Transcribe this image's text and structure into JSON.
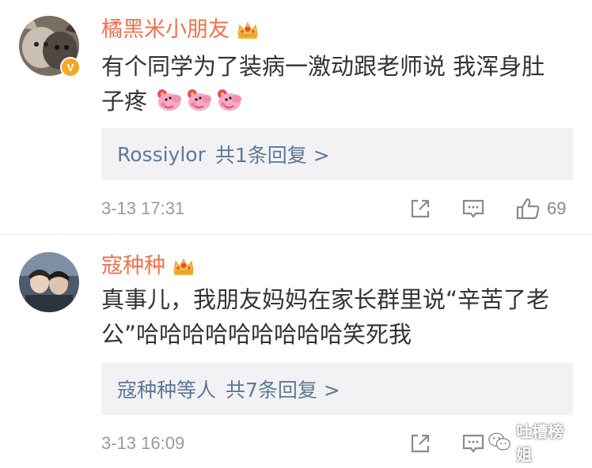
{
  "comments": [
    {
      "username": "橘黑米小朋友",
      "verified_badge": "V",
      "content_text": "有个同学为了装病一激动跟老师说 我浑身肚子疼",
      "content_line1": "有个同学为了装病一激动跟老师说 我浑身肚",
      "content_line2": "子疼",
      "emoji": [
        "peppa-pig-icon",
        "peppa-pig-icon",
        "peppa-pig-icon"
      ],
      "reply_summary": {
        "name": "Rossiylor",
        "count_label": "共1条回复 >"
      },
      "time": "3-13 17:31",
      "like_count": "69"
    },
    {
      "username": "寇种种",
      "content_text": "真事儿，我朋友妈妈在家长群里说“辛苦了老公”哈哈哈哈哈哈哈哈哈笑死我",
      "content_line1": "真事儿，我朋友妈妈在家长群里说“辛苦了老",
      "content_line2": "公”哈哈哈哈哈哈哈哈哈笑死我",
      "reply_summary": {
        "name": "寇种种等人",
        "count_label": "共7条回复 >"
      },
      "time": "3-13 16:09",
      "watermark": "吐槽榜姐"
    }
  ],
  "colors": {
    "username": "#eb7350",
    "reply_link": "#5d7895",
    "reply_bg": "#f2f2f5",
    "meta": "#9a9a9a",
    "verified": "#f5a623",
    "crown": "#f3b33d"
  },
  "icons": [
    "share-icon",
    "comment-icon",
    "thumbs-up-icon",
    "crown-icon",
    "wechat-icon"
  ]
}
